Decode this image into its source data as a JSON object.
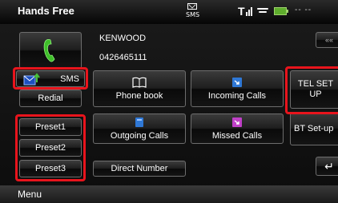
{
  "header": {
    "title": "Hands Free",
    "sms_status_label": "SMS",
    "time": "-- --"
  },
  "device": {
    "name": "KENWOOD",
    "number": "0426465111"
  },
  "left_panel": {
    "call_button_icon": "phone-handset-icon",
    "sms_label": "SMS",
    "redial_label": "Redial",
    "presets": [
      "Preset1",
      "Preset2",
      "Preset3"
    ]
  },
  "grid": {
    "phone_book": "Phone book",
    "incoming_calls": "Incoming Calls",
    "outgoing_calls": "Outgoing Calls",
    "missed_calls": "Missed Calls",
    "direct_number": "Direct Number"
  },
  "right_panel": {
    "top_button_label": "««",
    "tel_setup_label": "TEL SET UP",
    "bt_setup_label": "BT Set-up",
    "back_label": "↵"
  },
  "footer": {
    "menu_label": "Menu"
  },
  "colors": {
    "highlight": "#e8141c",
    "phone_green": "#3fbf2a",
    "icon_blue": "#2f78d6",
    "icon_purple": "#c040c8"
  }
}
